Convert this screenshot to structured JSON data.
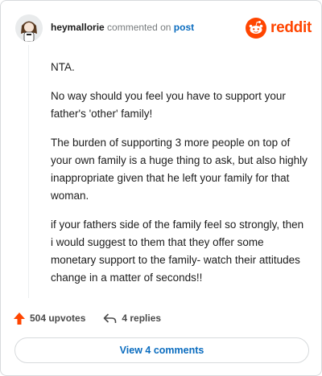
{
  "comment": {
    "username": "heymallorie",
    "action_text": "commented on",
    "post_link": "post",
    "paragraphs": [
      "NTA.",
      "No way should you feel you have to support your father's 'other' family!",
      "The burden of supporting 3 more people on top of your own family is a huge thing to ask, but also highly inappropriate given that he left your family for that woman.",
      "if your fathers side of the family feel so strongly, then i would suggest to them that they offer some monetary support to the family- watch their attitudes change in a matter of seconds!!"
    ]
  },
  "brand": {
    "name": "reddit",
    "color": "#ff4500"
  },
  "stats": {
    "upvotes": "504 upvotes",
    "replies": "4 replies"
  },
  "footer": {
    "view_comments_label": "View 4 comments"
  },
  "icons": {
    "avatar": "user-avatar",
    "logo": "reddit-alien-icon",
    "upvote": "upvote-arrow-icon",
    "reply": "reply-arrow-icon"
  },
  "colors": {
    "link": "#0a6cbf",
    "upvote": "#ff4500",
    "muted": "#787c7e"
  }
}
